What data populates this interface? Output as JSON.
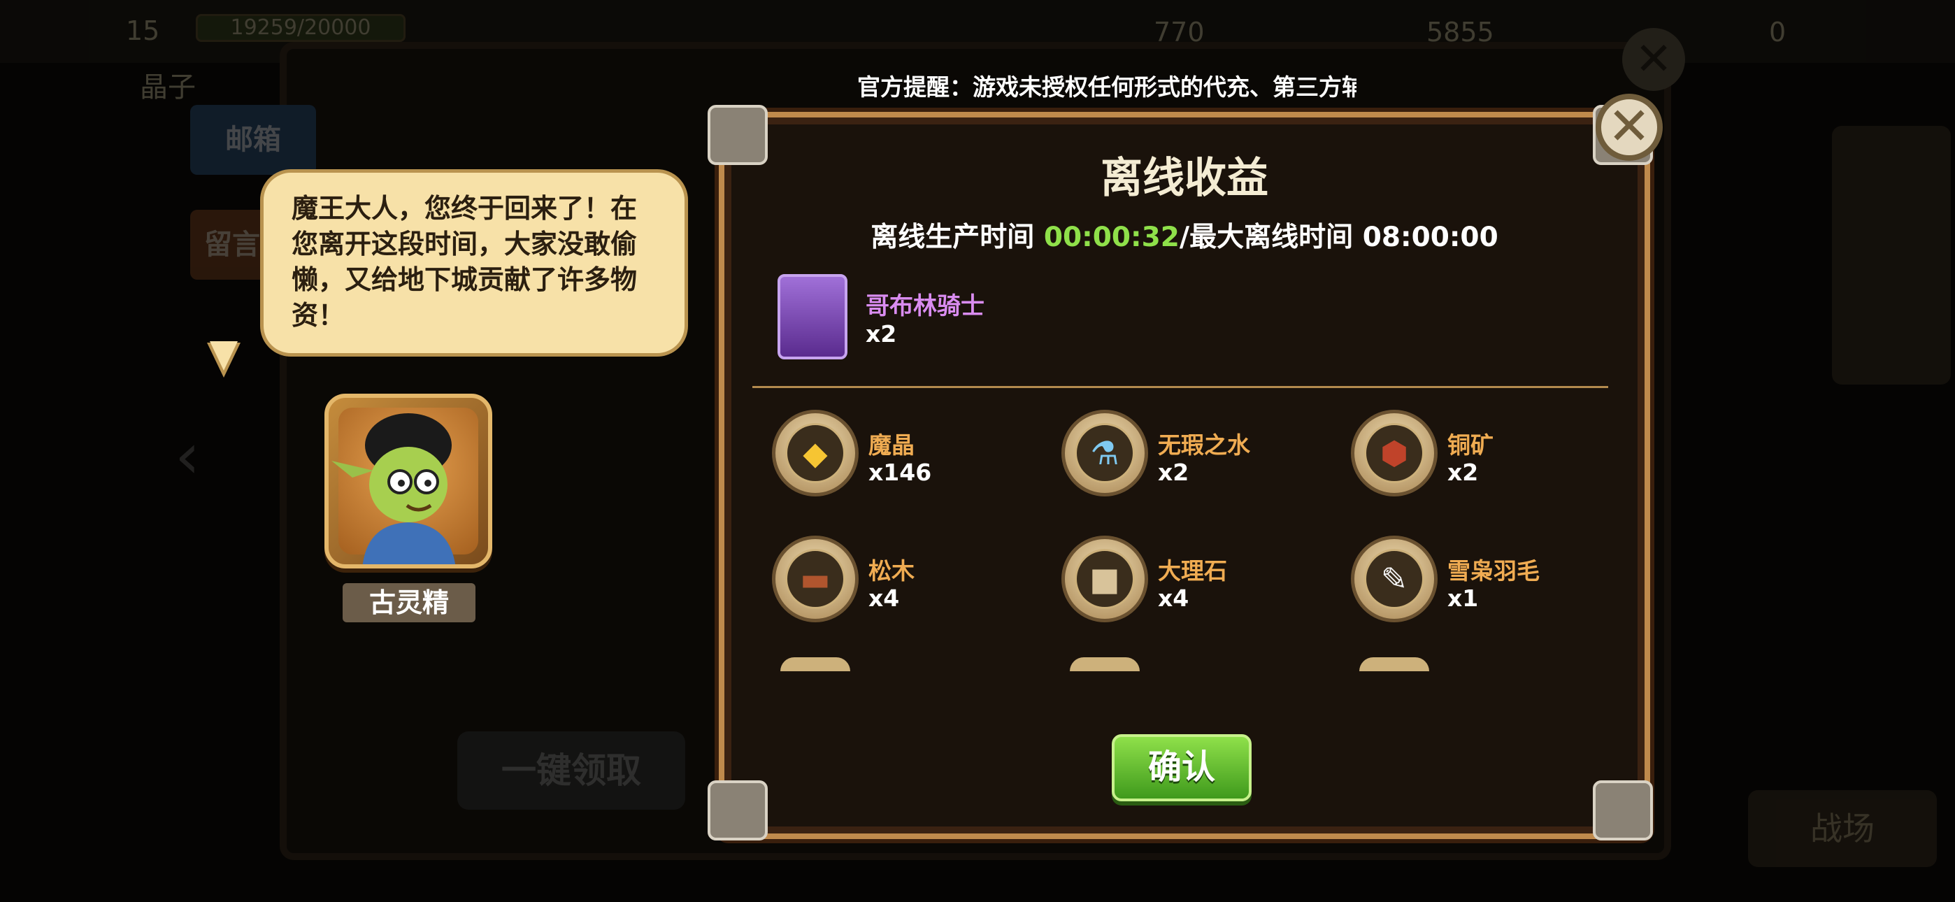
{
  "background": {
    "level": "15",
    "exp_text": "19259/20000",
    "resource_values": [
      "770",
      "5855",
      "0"
    ],
    "crystal_label": "晶子",
    "tabs": {
      "mail": "邮箱",
      "message": "留言"
    },
    "claim_all_label": "一键领取",
    "bottom_button": "战场"
  },
  "notice": {
    "text": "官方提醒：游戏未授权任何形式的代充、第三方辅"
  },
  "npc": {
    "speech": "魔王大人，您终于回来了！在您离开这段时间，大家没敢偷懒，又给地下城贡献了许多物资！",
    "name": "古灵精"
  },
  "dialog": {
    "title": "离线收益",
    "time_label": "离线生产时间 ",
    "time_value": "00:00:32",
    "max_label": "/最大离线时间 08:00:00",
    "hero": {
      "name": "哥布林骑士",
      "count": "x2"
    },
    "items": [
      {
        "name": "魔晶",
        "count": "x146",
        "icon": "crystal-icon"
      },
      {
        "name": "无瑕之水",
        "count": "x2",
        "icon": "water-bottle-icon"
      },
      {
        "name": "铜矿",
        "count": "x2",
        "icon": "copper-ore-icon"
      },
      {
        "name": "松木",
        "count": "x4",
        "icon": "pine-wood-icon"
      },
      {
        "name": "大理石",
        "count": "x4",
        "icon": "marble-icon"
      },
      {
        "name": "雪枭羽毛",
        "count": "x1",
        "icon": "feather-icon"
      }
    ],
    "confirm_label": "确认"
  },
  "colors": {
    "accent_green": "#8fe04a",
    "item_name_orange": "#f0ac52",
    "hero_name_purple": "#d98cf0",
    "frame_gold": "#c08a4c"
  }
}
